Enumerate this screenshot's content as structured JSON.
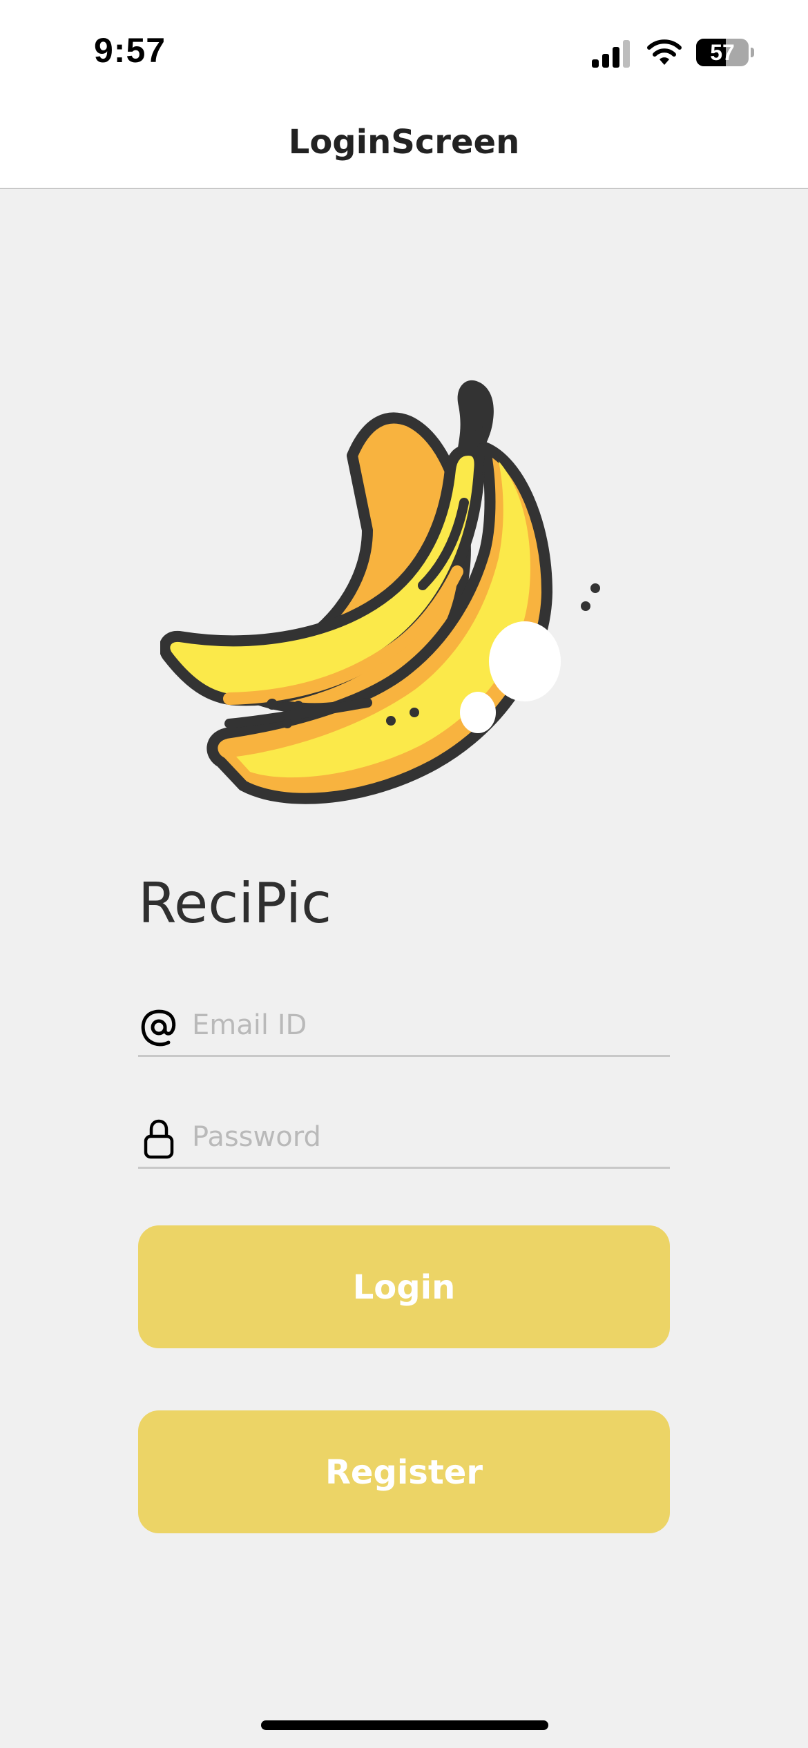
{
  "status_bar": {
    "time": "9:57",
    "battery_level": "57",
    "icons": [
      "cellular-signal-icon",
      "wifi-icon",
      "battery-icon"
    ]
  },
  "nav": {
    "title": "LoginScreen"
  },
  "app": {
    "name": "ReciPic",
    "logo": "banana-logo"
  },
  "form": {
    "email": {
      "placeholder": "Email ID",
      "value": "",
      "icon": "at-sign-icon"
    },
    "password": {
      "placeholder": "Password",
      "value": "",
      "icon": "lock-icon"
    },
    "login_label": "Login",
    "register_label": "Register"
  },
  "colors": {
    "button": "#ecd466",
    "background": "#f0f0f0",
    "banana_yellow": "#fbe94a",
    "banana_orange": "#f8b33f",
    "outline": "#333333"
  }
}
